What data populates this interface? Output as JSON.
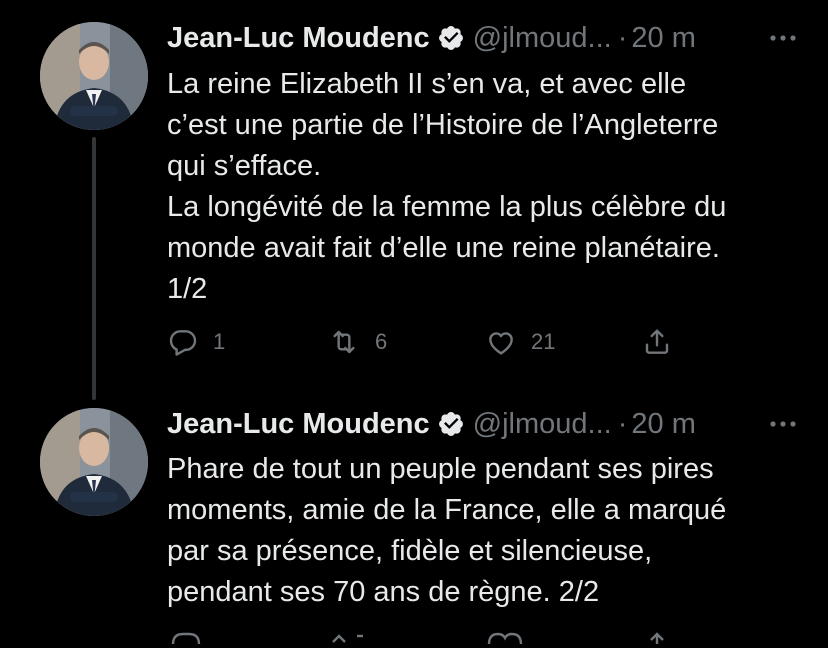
{
  "colors": {
    "background": "#000000",
    "text": "#e7e9ea",
    "muted": "#71767b",
    "thread_line": "#333639",
    "verified_badge": "#e7e9ea"
  },
  "tweets": [
    {
      "author": {
        "name": "Jean-Luc Moudenc",
        "handle": "@jlmoud...",
        "verified_icon": "verified-badge-icon"
      },
      "separator": "·",
      "time": "20 m",
      "lines": [
        "La reine Elizabeth II s’en va, et avec elle",
        "c’est une partie de l’Histoire de l’Angleterre",
        "qui s’efface.",
        "La longévité de la femme la plus célèbre du",
        "monde avait fait d’elle une reine planétaire.",
        "1/2"
      ],
      "actions": {
        "reply_count": "1",
        "retweet_count": "6",
        "like_count": "21"
      }
    },
    {
      "author": {
        "name": "Jean-Luc Moudenc",
        "handle": "@jlmoud...",
        "verified_icon": "verified-badge-icon"
      },
      "separator": "·",
      "time": "20 m",
      "lines": [
        "Phare de tout un peuple pendant ses pires",
        "moments, amie de la France, elle a marqué",
        "par sa présence, fidèle et silencieuse,",
        "pendant ses 70 ans de règne.  2/2"
      ]
    }
  ]
}
